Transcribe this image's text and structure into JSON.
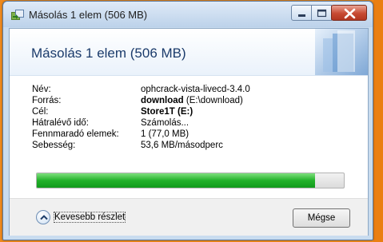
{
  "window": {
    "title": "Másolás 1 elem (506 MB)",
    "header": "Másolás 1 elem (506 MB)"
  },
  "details": [
    {
      "label": "Név:",
      "value": "ophcrack-vista-livecd-3.4.0",
      "extra": ""
    },
    {
      "label": "Forrás:",
      "value": "download",
      "extra": " (E:\\download)"
    },
    {
      "label": "Cél:",
      "value": "Store1T (E:)",
      "extra": ""
    },
    {
      "label": "Hátralévő idő:",
      "value": "Számolás...",
      "extra": ""
    },
    {
      "label": "Fennmaradó elemek:",
      "value": "1 (77,0 MB)",
      "extra": ""
    },
    {
      "label": "Sebesség:",
      "value": "53,6 MB/másodperc",
      "extra": ""
    }
  ],
  "progress": {
    "fraction": 0.905,
    "color": "#22b12a"
  },
  "footer": {
    "less_details": "Kevesebb részlet",
    "cancel": "Mégse"
  },
  "icons": [
    "copy-window-icon",
    "minimize-icon",
    "maximize-icon",
    "close-icon",
    "chevron-up-icon"
  ]
}
